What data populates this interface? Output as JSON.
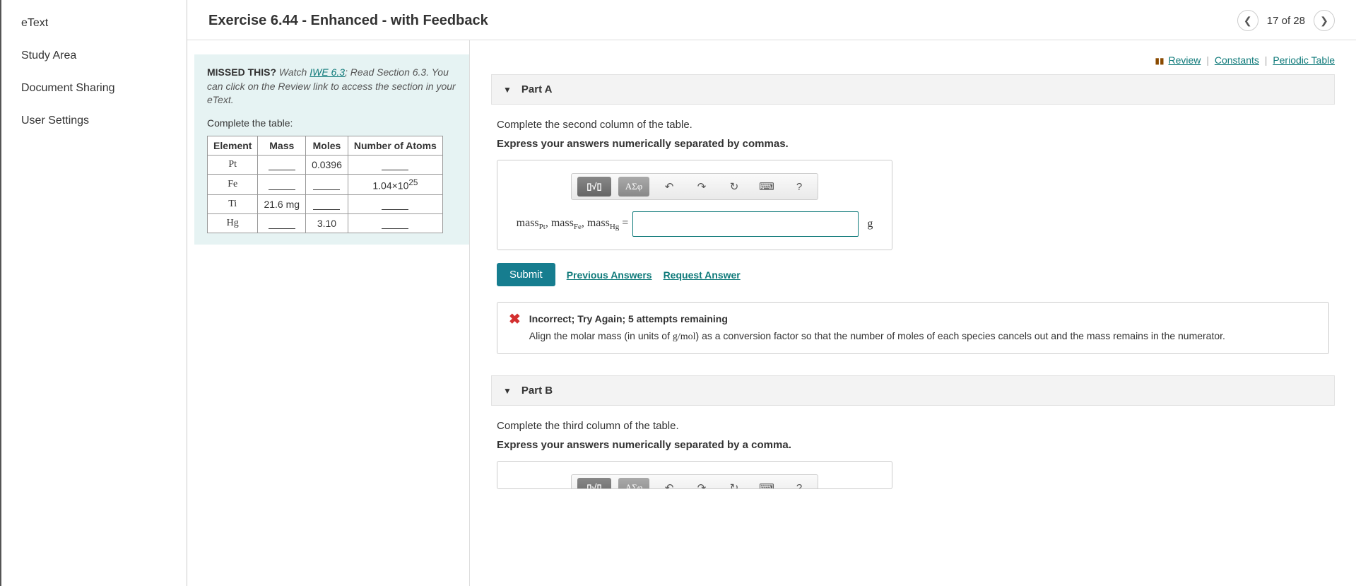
{
  "sidebar": {
    "items": [
      {
        "label": "eText"
      },
      {
        "label": "Study Area"
      },
      {
        "label": "Document Sharing"
      },
      {
        "label": "User Settings"
      }
    ]
  },
  "header": {
    "title": "Exercise 6.44 - Enhanced - with Feedback",
    "pager": "17 of 28"
  },
  "toplinks": {
    "review": "Review",
    "constants": "Constants",
    "periodic": "Periodic Table"
  },
  "infobox": {
    "missed_label": "MISSED THIS?",
    "watch": " Watch ",
    "iwe": "IWE 6.3",
    "read": "; Read Section 6.3. You can click on the Review link to access the section in your eText.",
    "complete": "Complete the table:"
  },
  "table": {
    "headers": [
      "Element",
      "Mass",
      "Moles",
      "Number of Atoms"
    ],
    "rows": [
      {
        "el": "Pt",
        "mass": "",
        "moles": "0.0396",
        "atoms": ""
      },
      {
        "el": "Fe",
        "mass": "",
        "moles": "",
        "atoms": "1.04×10",
        "atoms_exp": "25"
      },
      {
        "el": "Ti",
        "mass": "21.6 mg",
        "moles": "",
        "atoms": ""
      },
      {
        "el": "Hg",
        "mass": "",
        "moles": "3.10",
        "atoms": ""
      }
    ]
  },
  "partA": {
    "label": "Part A",
    "prompt": "Complete the second column of the table.",
    "instruction": "Express your answers numerically separated by commas.",
    "answer_label_html": "mass<sub>Pt</sub>, mass<sub>Fe</sub>, mass<sub>Hg</sub> =",
    "unit": "g",
    "submit": "Submit",
    "prev": "Previous Answers",
    "request": "Request Answer"
  },
  "feedback": {
    "head": "Incorrect; Try Again; 5 attempts remaining",
    "body_pre": "Align the molar mass (in units of ",
    "gmol": "g/mol",
    "body_post": ") as a conversion factor so that the number of moles of each species cancels out and the mass remains in the numerator."
  },
  "partB": {
    "label": "Part B",
    "prompt": "Complete the third column of the table.",
    "instruction": "Express your answers numerically separated by a comma."
  },
  "toolbar_labels": {
    "templates": "▯√▯",
    "greek": "ΑΣφ"
  }
}
